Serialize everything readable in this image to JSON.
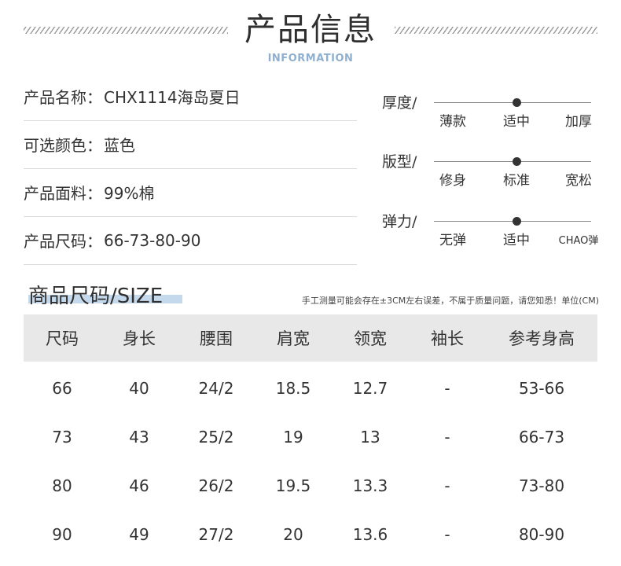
{
  "header": {
    "title": "产品信息",
    "subtitle": "INFORMATION"
  },
  "info": [
    {
      "label": "产品名称：",
      "value": "CHX1114海岛夏日"
    },
    {
      "label": "可选颜色：",
      "value": "蓝色"
    },
    {
      "label": "产品面料：",
      "value": "99%棉"
    },
    {
      "label": "产品尺码：",
      "value": "66-73-80-90"
    }
  ],
  "scales": [
    {
      "label": "厚度/",
      "options": [
        "薄款",
        "适中",
        "加厚"
      ],
      "selected": "适中"
    },
    {
      "label": "版型/",
      "options": [
        "修身",
        "标准",
        "宽松"
      ],
      "selected": "标准"
    },
    {
      "label": "弹力/",
      "options": [
        "无弹",
        "适中",
        "CHAO弹"
      ],
      "selected": "适中"
    }
  ],
  "size_section": {
    "title": "商品尺码/SIZE",
    "note": "手工测量可能会存在±3CM左右误差，不属于质量问题，请您知悉！单位(CM)",
    "headers": [
      "尺码",
      "身长",
      "腰围",
      "肩宽",
      "领宽",
      "袖长",
      "参考身高"
    ],
    "rows": [
      [
        "66",
        "40",
        "24/2",
        "18.5",
        "12.7",
        "-",
        "53-66"
      ],
      [
        "73",
        "43",
        "25/2",
        "19",
        "13",
        "-",
        "66-73"
      ],
      [
        "80",
        "46",
        "26/2",
        "19.5",
        "13.3",
        "-",
        "73-80"
      ],
      [
        "90",
        "49",
        "27/2",
        "20",
        "13.6",
        "-",
        "80-90"
      ]
    ]
  }
}
